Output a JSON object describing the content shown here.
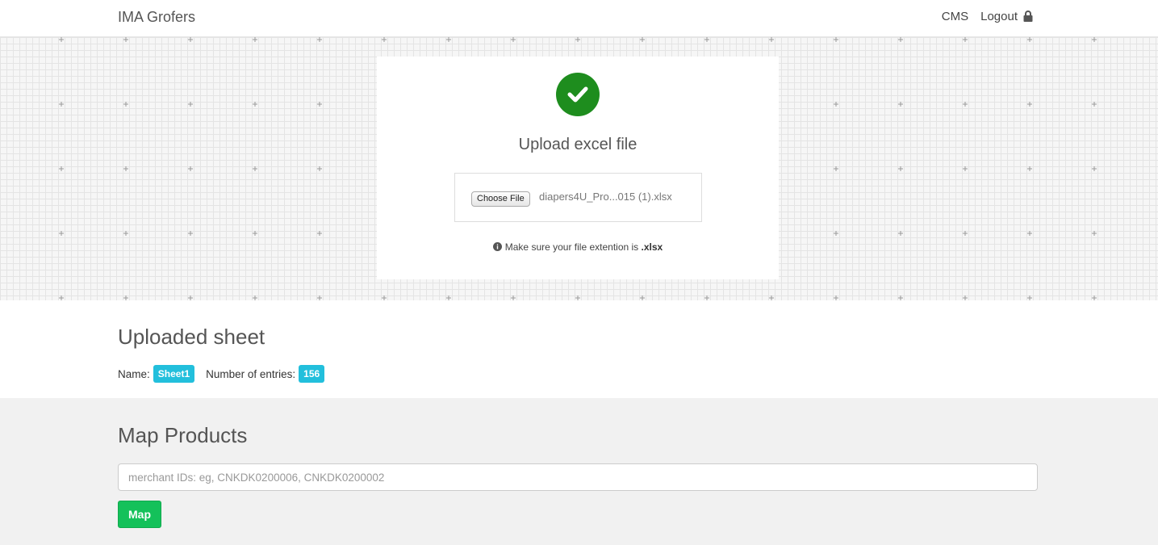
{
  "nav": {
    "brand": "IMA Grofers",
    "cms": "CMS",
    "logout": "Logout"
  },
  "upload": {
    "title": "Upload excel file",
    "choose_file": "Choose File",
    "file_name": "diapers4U_Pro...015 (1).xlsx",
    "hint_prefix": "Make sure your file extention is",
    "hint_ext": ".xlsx",
    "status_color": "#1e8d1e"
  },
  "uploaded_sheet": {
    "heading": "Uploaded sheet",
    "name_label": "Name:",
    "name_value": "Sheet1",
    "entries_label": "Number of entries:",
    "entries_value": "156",
    "badge_color": "#22bfdc"
  },
  "map_products": {
    "heading": "Map Products",
    "input_placeholder": "merchant IDs: eg, CNKDK0200006, CNKDK0200002",
    "input_value": "",
    "button_label": "Map",
    "button_color": "#14c15a"
  }
}
